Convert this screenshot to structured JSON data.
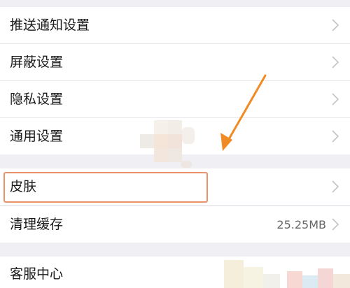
{
  "settings": {
    "items": [
      {
        "label": "推送通知设置",
        "value": ""
      },
      {
        "label": "屏蔽设置",
        "value": ""
      },
      {
        "label": "隐私设置",
        "value": ""
      },
      {
        "label": "通用设置",
        "value": ""
      },
      {
        "label": "皮肤",
        "value": ""
      },
      {
        "label": "清理缓存",
        "value": "25.25MB"
      },
      {
        "label": "客服中心",
        "value": ""
      }
    ]
  },
  "icons": {
    "chevron": "chevron-right-icon"
  },
  "colors": {
    "background": "#efeff4",
    "row": "#ffffff",
    "highlight_border": "#e8926a",
    "annotation_arrow": "#f08a24"
  }
}
